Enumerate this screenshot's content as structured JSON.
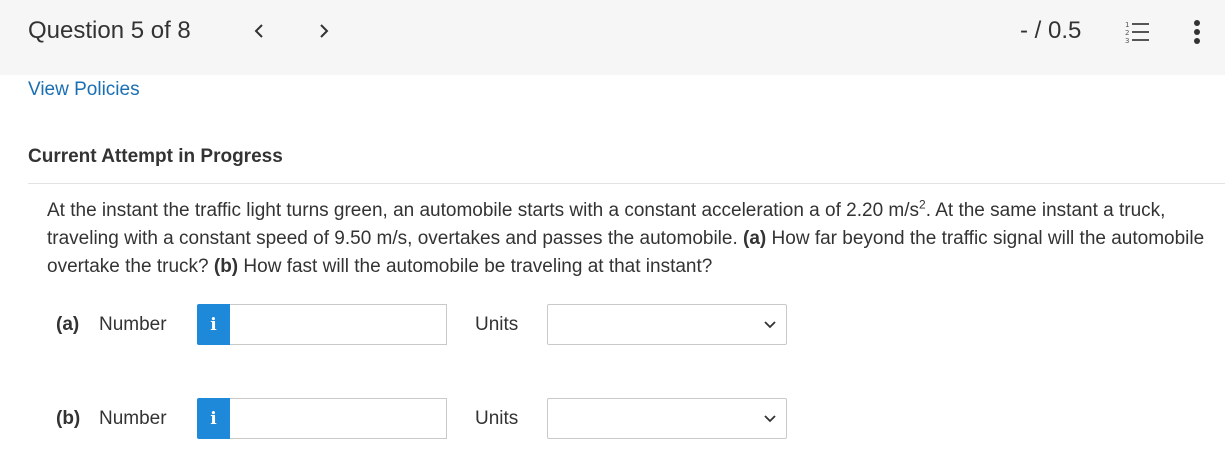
{
  "header": {
    "question_title": "Question 5 of 8",
    "prev_symbol": "<",
    "next_symbol": ">",
    "score": "- / 0.5",
    "list_icon": "numbered-list-icon",
    "more_icon": "vertical-ellipsis-icon"
  },
  "links": {
    "view_policies": "View Policies"
  },
  "attempt": {
    "heading": "Current Attempt in Progress"
  },
  "question": {
    "text_1": "At the instant the traffic light turns green, an automobile starts with a constant acceleration a of 2.20 m/s",
    "text_sup": "2",
    "text_2": ". At the same instant a truck, traveling with a constant speed of 9.50 m/s, overtakes and passes the automobile. ",
    "part_a_tag": "(a)",
    "part_a_text": " How far beyond the traffic signal will the automobile overtake the truck? ",
    "part_b_tag": "(b)",
    "part_b_text": " How fast will the automobile be traveling at that instant?"
  },
  "answers": [
    {
      "part_label": "(a)",
      "number_label": "Number",
      "info_symbol": "i",
      "number_value": "",
      "units_label": "Units",
      "units_value": ""
    },
    {
      "part_label": "(b)",
      "number_label": "Number",
      "info_symbol": "i",
      "number_value": "",
      "units_label": "Units",
      "units_value": ""
    }
  ],
  "colors": {
    "link": "#1a6fb3",
    "info_button": "#1e88d9",
    "header_bg": "#f6f6f6"
  }
}
